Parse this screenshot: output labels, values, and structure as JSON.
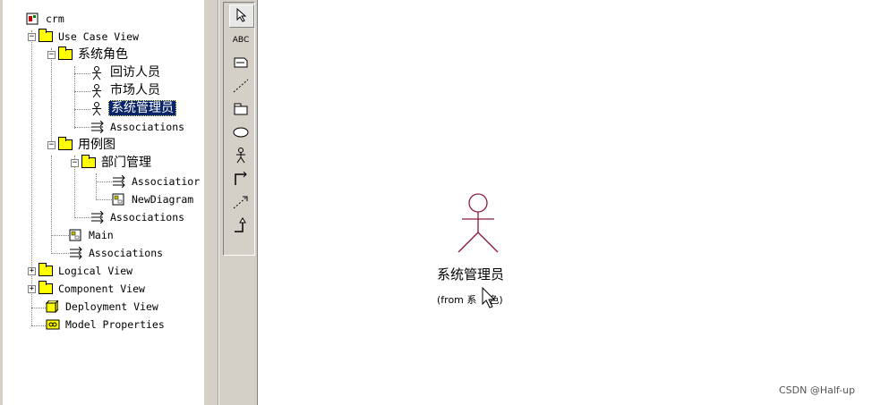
{
  "tree": {
    "root": "crm",
    "use_case_view": "Use Case View",
    "system_roles": "系统角色",
    "actor_visit": "回访人员",
    "actor_market": "市场人员",
    "actor_admin": "系统管理员",
    "associations_1": "Associations",
    "use_case_diagram": "用例图",
    "dept_mgmt": "部门管理",
    "association_trunc": "Associatior",
    "new_diagram": "NewDiagram",
    "associations_2": "Associations",
    "main": "Main",
    "associations_3": "Associations",
    "logical_view": "Logical View",
    "component_view": "Component View",
    "deployment_view": "Deployment View",
    "model_properties": "Model Properties"
  },
  "toolbox": {
    "text_tool": "ABC"
  },
  "canvas": {
    "actor_name": "系统管理员",
    "actor_from_prefix": "(from 系",
    "actor_from_suffix": "色)"
  },
  "watermark": "CSDN @Half-up",
  "colors": {
    "selection_bg": "#0a246a",
    "folder": "#ffff00",
    "actor_stroke": "#8b1a3a",
    "panel": "#d4d0c8"
  }
}
